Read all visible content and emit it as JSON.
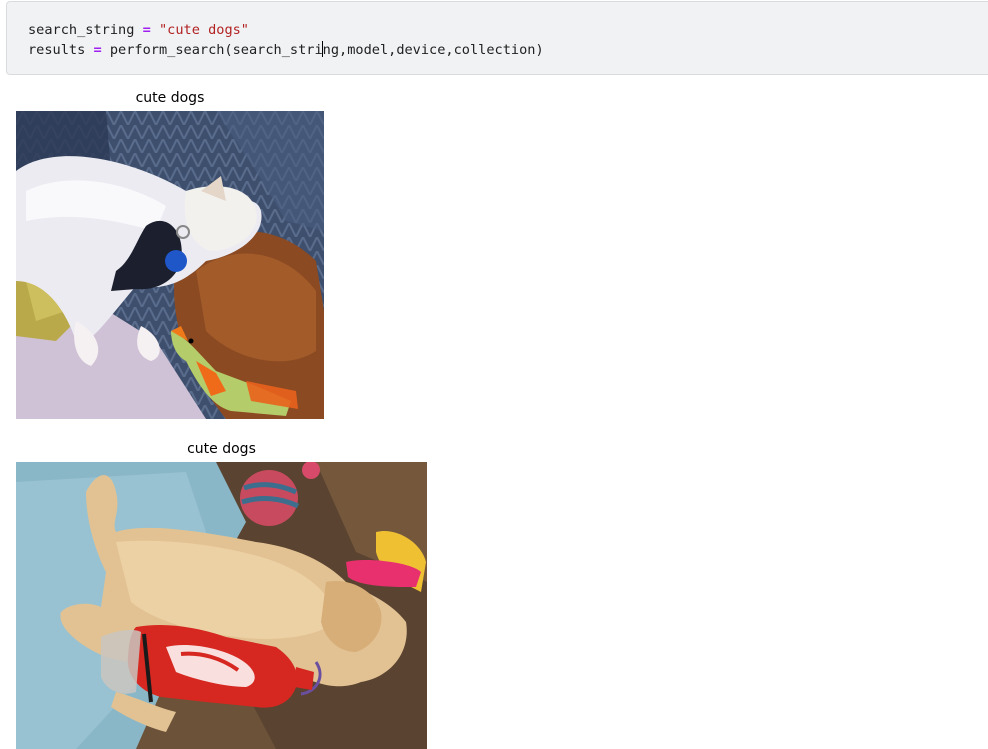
{
  "code_cell": {
    "line1": {
      "var": "search_string",
      "op": "=",
      "value": "\"cute dogs\""
    },
    "line2": {
      "var": "results",
      "op": "=",
      "call_before_caret": "perform_search(search_stri",
      "call_after_caret": "ng,model,device,collection)"
    }
  },
  "results": [
    {
      "caption": "cute dogs",
      "image_icon": "photo-white-dog-and-brown-dog-sleeping"
    },
    {
      "caption": "cute dogs",
      "image_icon": "photo-golden-puppy-sleeping-with-cola-bottle"
    }
  ],
  "colors": {
    "cell_background": "#f1f2f4",
    "keyword_operator": "#a020f0",
    "string_literal": "#b22222"
  }
}
